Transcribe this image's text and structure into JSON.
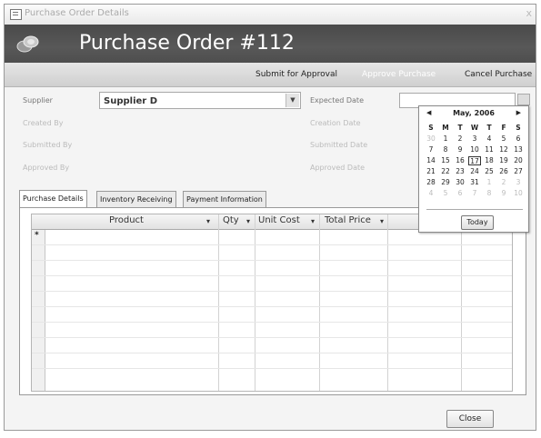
{
  "window": {
    "title": "Purchase Order Details",
    "close_glyph": "x"
  },
  "header": {
    "title": "Purchase Order #112",
    "logo_icon": "coins-icon"
  },
  "actions": {
    "submit": "Submit for Approval",
    "approve": "Approve Purchase",
    "cancel": "Cancel Purchase"
  },
  "fields": {
    "supplier_label": "Supplier",
    "supplier_value": "Supplier D",
    "created_by_label": "Created By",
    "submitted_by_label": "Submitted By",
    "approved_by_label": "Approved By",
    "expected_date_label": "Expected Date",
    "creation_date_label": "Creation Date",
    "submitted_date_label": "Submitted Date",
    "approved_date_label": "Approved Date"
  },
  "calendar": {
    "month": "May, 2006",
    "prev": "◀",
    "next": "▶",
    "weekdays": [
      "S",
      "M",
      "T",
      "W",
      "T",
      "F",
      "S"
    ],
    "weeks": [
      [
        "30",
        "1",
        "2",
        "3",
        "4",
        "5",
        "6"
      ],
      [
        "7",
        "8",
        "9",
        "10",
        "11",
        "12",
        "13"
      ],
      [
        "14",
        "15",
        "16",
        "17",
        "18",
        "19",
        "20"
      ],
      [
        "21",
        "22",
        "23",
        "24",
        "25",
        "26",
        "27"
      ],
      [
        "28",
        "29",
        "30",
        "31",
        "1",
        "2",
        "3"
      ],
      [
        "4",
        "5",
        "6",
        "7",
        "8",
        "9",
        "10"
      ]
    ],
    "selected": "17",
    "today_label": "Today"
  },
  "tabs": [
    "Purchase Details",
    "Inventory Receiving",
    "Payment Information"
  ],
  "grid": {
    "columns": [
      "Product",
      "Qty",
      "Unit Cost",
      "Total Price"
    ],
    "new_row_marker": "*"
  },
  "footer": {
    "close_label": "Close"
  }
}
